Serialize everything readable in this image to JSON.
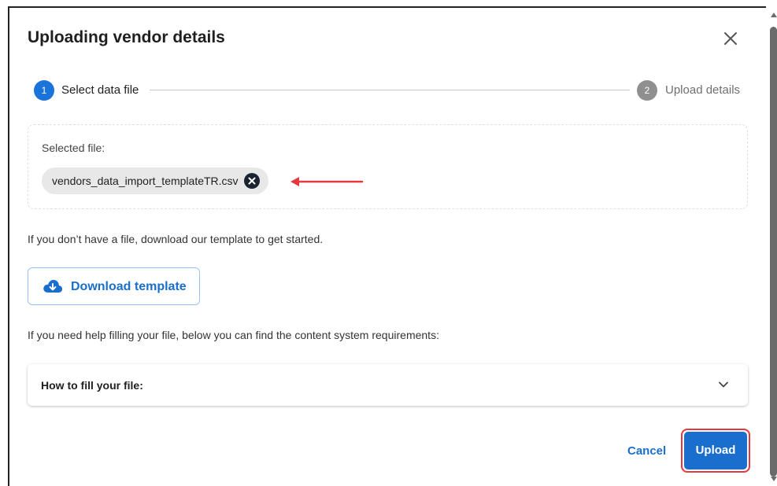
{
  "dialog": {
    "title": "Uploading vendor details",
    "close_icon": "close-icon"
  },
  "stepper": {
    "steps": [
      {
        "number": "1",
        "label": "Select data file",
        "state": "active",
        "color": "#1a73d9"
      },
      {
        "number": "2",
        "label": "Upload details",
        "state": "inactive",
        "color": "#8f8f8f"
      }
    ]
  },
  "file_section": {
    "label": "Selected file:",
    "file_name": "vendors_data_import_templateTR.csv",
    "remove_icon": "remove-circle-icon"
  },
  "template_section": {
    "hint": "If you don’t have a file, download our template to get started.",
    "button_label": "Download template",
    "button_icon": "cloud-download-icon"
  },
  "help_section": {
    "hint": "If you need help filling your file, below you can find the content system requirements:",
    "accordion_title": "How to fill your file:",
    "accordion_icon": "chevron-down-icon"
  },
  "footer": {
    "cancel_label": "Cancel",
    "upload_label": "Upload"
  },
  "colors": {
    "accent": "#1a6fce",
    "annotation": "#e5393f"
  }
}
